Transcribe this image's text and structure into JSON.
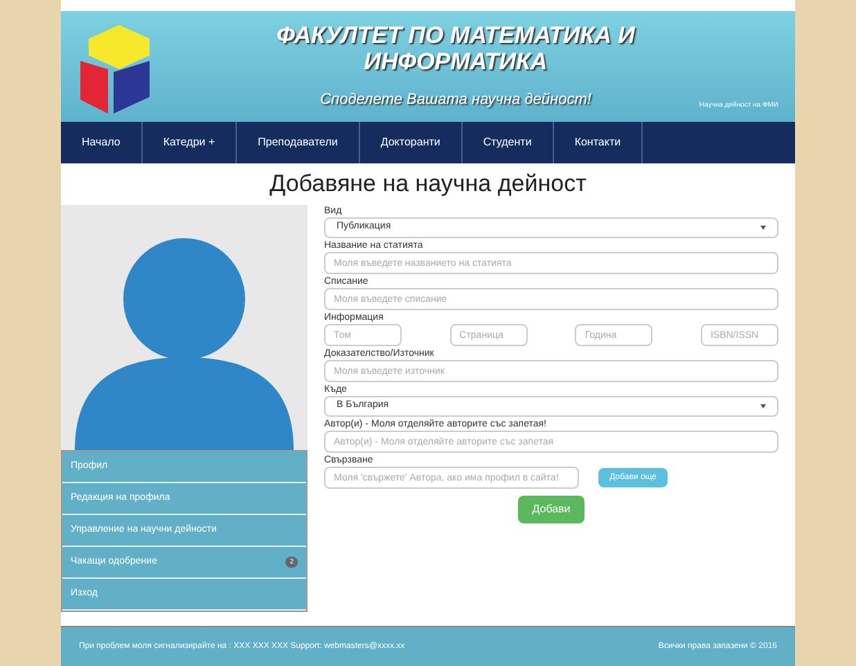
{
  "header": {
    "title": "ФАКУЛТЕТ ПО МАТЕМАТИКА И ИНФОРМАТИКА",
    "slogan": "Споделете Вашата научна дейност!",
    "caption": "Научна дейност на ФМИ"
  },
  "nav": [
    {
      "label": "Начало"
    },
    {
      "label": "Катедри +"
    },
    {
      "label": "Преподаватели"
    },
    {
      "label": "Докторанти"
    },
    {
      "label": "Студенти"
    },
    {
      "label": "Контакти"
    }
  ],
  "page_title": "Добавяне на научна дейност",
  "sidebar": {
    "items": [
      {
        "label": "Профил"
      },
      {
        "label": "Редакция на профила"
      },
      {
        "label": "Управление на научни дейности"
      },
      {
        "label": "Чакащи одобрение",
        "badge": "2"
      },
      {
        "label": "Изход"
      }
    ]
  },
  "form": {
    "rows": [
      {
        "label": "Вид",
        "fields": [
          {
            "kind": "select",
            "value": "Публикация"
          }
        ]
      },
      {
        "label": "Название на статията",
        "fields": [
          {
            "kind": "text",
            "placeholder": "Моля въведете названието на статията"
          }
        ]
      },
      {
        "label": "Списание",
        "fields": [
          {
            "kind": "text",
            "placeholder": "Моля въведете списание"
          }
        ]
      },
      {
        "label": "Информация",
        "fields": [
          {
            "kind": "text",
            "placeholder": "Том"
          },
          {
            "kind": "text",
            "placeholder": "Страница"
          },
          {
            "kind": "text",
            "placeholder": "Година"
          },
          {
            "kind": "text",
            "placeholder": "ISBN/ISSN"
          }
        ]
      },
      {
        "label": "Доказателство/Източник",
        "fields": [
          {
            "kind": "text",
            "placeholder": "Моля въведете източник"
          }
        ]
      },
      {
        "label": "Къде",
        "fields": [
          {
            "kind": "select",
            "value": "В България"
          }
        ]
      },
      {
        "label": "Автор(и) - Моля отделяйте авторите със запетая!",
        "fields": [
          {
            "kind": "text",
            "placeholder": "Автор(и) - Моля отделяйте авторите със запетая"
          }
        ]
      },
      {
        "label": "Свързване",
        "fields": [
          {
            "kind": "text",
            "placeholder": "Моля 'свържете' Автора, ако има профил в сайта!"
          },
          {
            "kind": "button",
            "label": "Добави още"
          }
        ]
      }
    ],
    "submit": "Добави"
  },
  "footer": {
    "contact": "При проблем моля сигнализирайте на : XXX XXX XXX Support: webmasters@xxxx.xx",
    "copyright": "Всички права запазени © 2016"
  }
}
